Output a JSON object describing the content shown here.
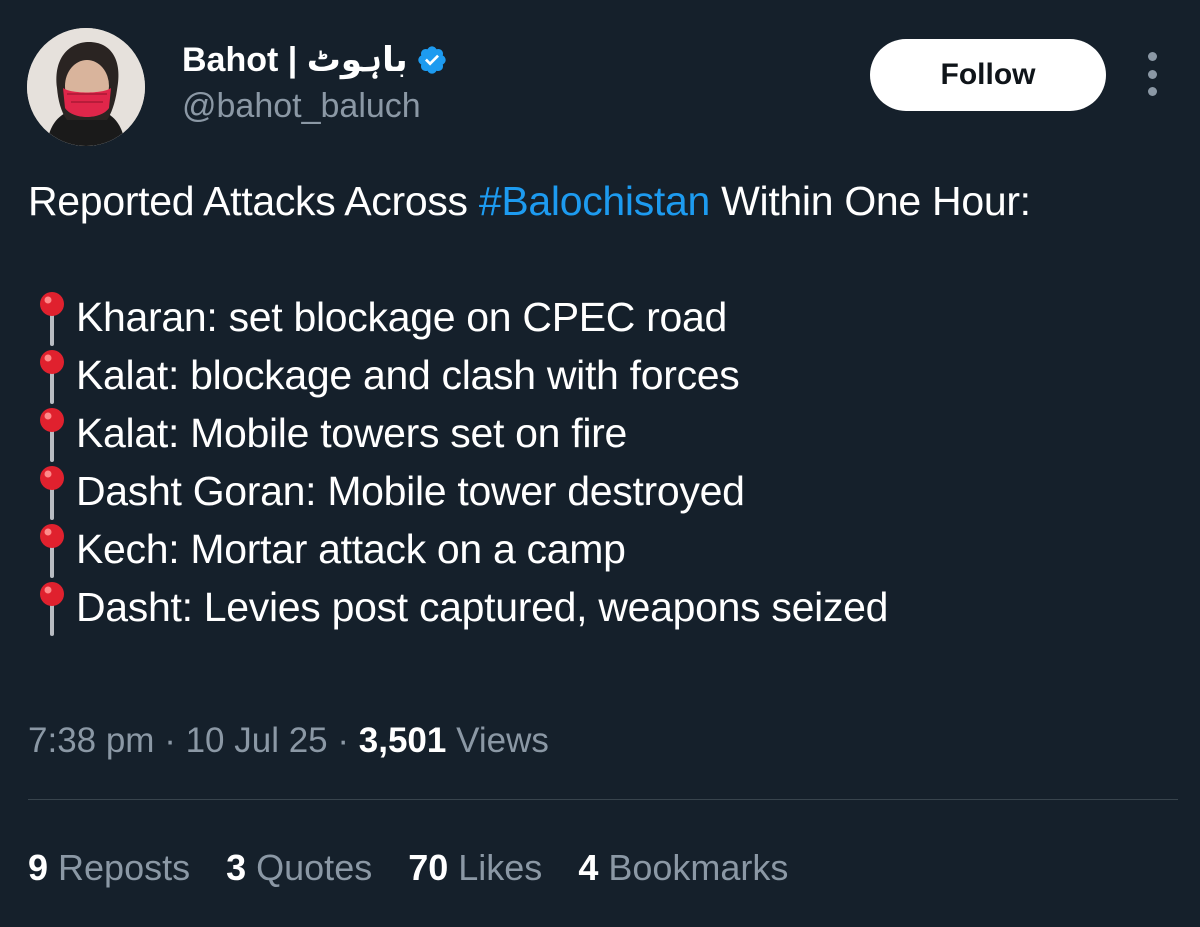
{
  "author": {
    "display_name": "Bahot | باہوٹ",
    "handle": "@bahot_baluch",
    "verified": true,
    "avatar_icon": "profile-photo-woman-red-mask"
  },
  "actions": {
    "follow_label": "Follow",
    "more_icon": "more-vertical-icon"
  },
  "tweet": {
    "intro_before": "Reported Attacks Across ",
    "hashtag": "#Balochistan",
    "intro_after": " Within One Hour:",
    "items": [
      "Kharan: set blockage on CPEC road",
      "Kalat: blockage and clash with forces",
      "Kalat: Mobile towers set on fire",
      "Dasht Goran: Mobile tower destroyed",
      "Kech: Mortar attack on a camp",
      "Dasht: Levies post captured, weapons seized"
    ],
    "item_icon": "round-pushpin-icon"
  },
  "meta": {
    "time": "7:38 pm",
    "date": "10 Jul 25",
    "views_count": "3,501",
    "views_label": "Views",
    "separator": "·"
  },
  "stats": {
    "reposts_count": "9",
    "reposts_label": "Reposts",
    "quotes_count": "3",
    "quotes_label": "Quotes",
    "likes_count": "70",
    "likes_label": "Likes",
    "bookmarks_count": "4",
    "bookmarks_label": "Bookmarks"
  },
  "colors": {
    "background": "#15202b",
    "text": "#ffffff",
    "secondary_text": "#8b98a5",
    "link": "#1d9bf0",
    "verified": "#1d9bf0",
    "divider": "#38444d",
    "pin": "#e0212e"
  }
}
